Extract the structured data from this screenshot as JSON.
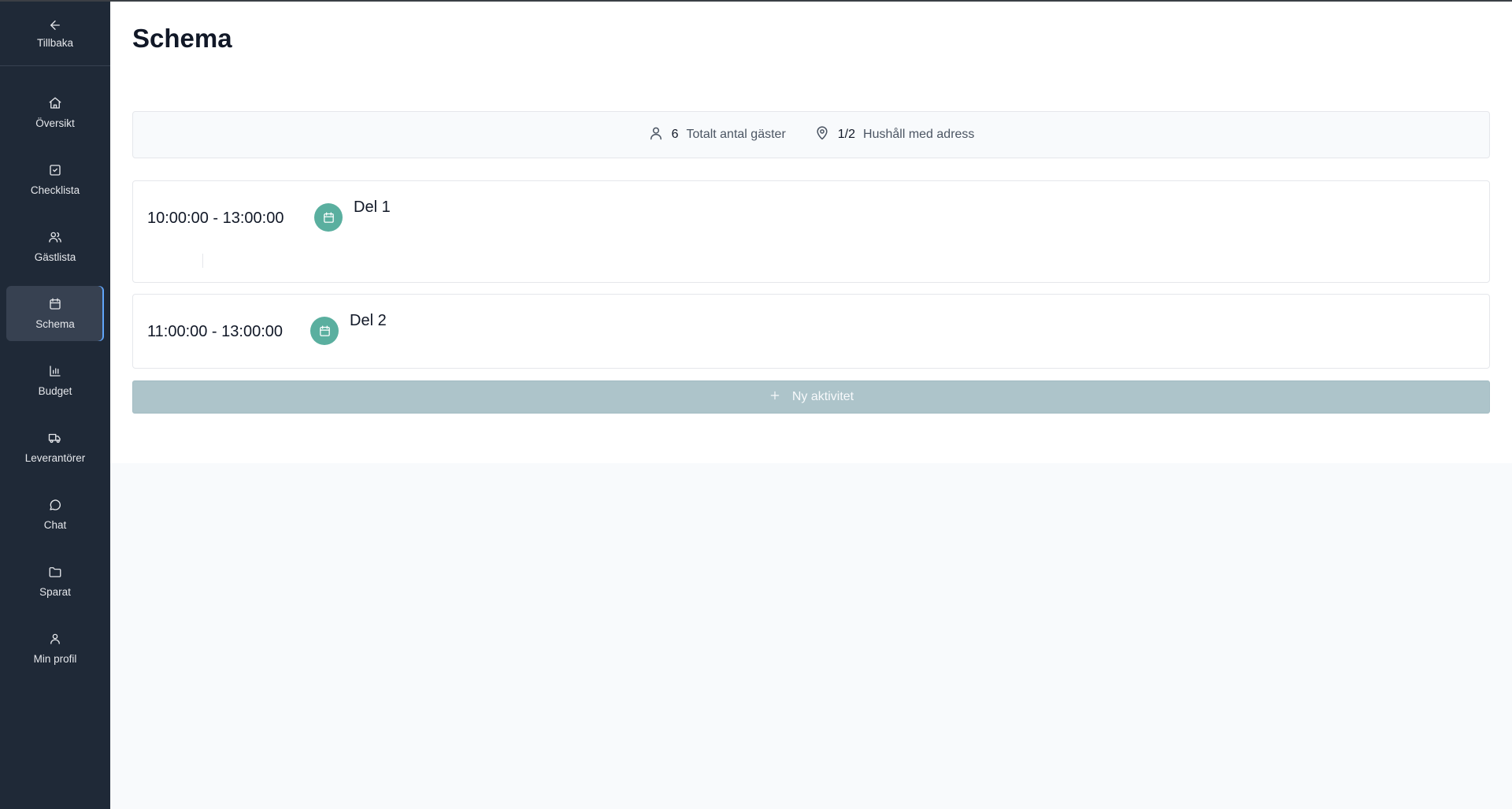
{
  "sidebar": {
    "back_label": "Tillbaka",
    "items": [
      {
        "label": "Översikt",
        "icon": "home-icon"
      },
      {
        "label": "Checklista",
        "icon": "checkbox-icon"
      },
      {
        "label": "Gästlista",
        "icon": "users-icon"
      },
      {
        "label": "Schema",
        "icon": "calendar-icon",
        "active": true
      },
      {
        "label": "Budget",
        "icon": "bar-chart-icon"
      },
      {
        "label": "Leverantörer",
        "icon": "truck-icon"
      },
      {
        "label": "Chat",
        "icon": "chat-bubble-icon"
      },
      {
        "label": "Sparat",
        "icon": "folder-icon"
      },
      {
        "label": "Min profil",
        "icon": "user-icon"
      }
    ]
  },
  "page": {
    "title": "Schema"
  },
  "stats": {
    "guests_value": "6",
    "guests_label": "Totalt antal gäster",
    "households_value": "1/2",
    "households_label": "Hushåll med adress"
  },
  "activities": [
    {
      "time": "10:00:00 - 13:00:00",
      "title": "Del 1"
    },
    {
      "time": "11:00:00 - 13:00:00",
      "title": "Del 2"
    }
  ],
  "new_activity_label": "Ny aktivitet",
  "colors": {
    "sidebar_bg": "#1f2937",
    "badge": "#5aaf9f",
    "new_button": "#adc4ca",
    "active_indicator": "#60a5fa"
  }
}
